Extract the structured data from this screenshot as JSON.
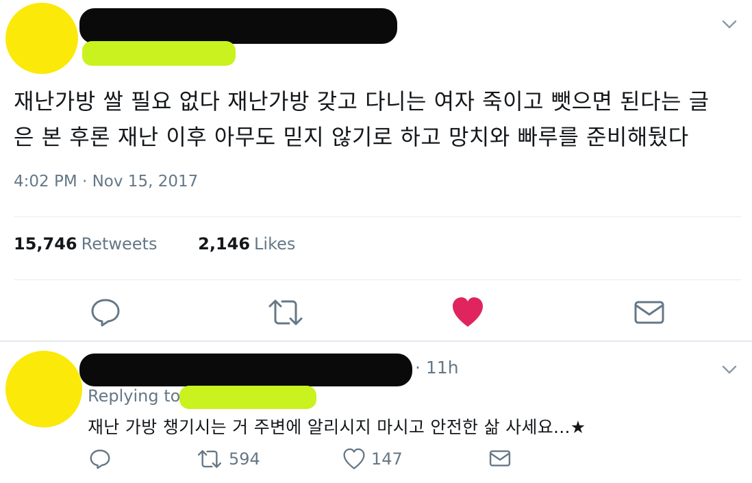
{
  "colors": {
    "avatar": "#fbe90a",
    "redaction": "#0a0a0a",
    "handle_highlight": "#c9f21f",
    "secondary_text": "#657786",
    "like_active": "#e0245e"
  },
  "main_tweet": {
    "text": "재난가방 쌀 필요 없다 재난가방 갖고 다니는 여자 죽이고 뺏으면 된다는 글\n은 본 후론 재난 이후 아무도 믿지 않기로 하고 망치와 빠루를 준비해뒀다",
    "timestamp": "4:02 PM · Nov 15, 2017",
    "retweets_count": "15,746",
    "retweets_label": "Retweets",
    "likes_count": "2,146",
    "likes_label": "Likes",
    "icons": {
      "menu": "chevron-down-icon",
      "reply": "reply-icon",
      "retweet": "retweet-icon",
      "like": "heart-icon",
      "dm": "envelope-icon"
    }
  },
  "reply_tweet": {
    "time": "· 11h",
    "replying_to": "Replying to",
    "text": "재난 가방 챙기시는 거 주변에 알리시지 마시고 안전한 삶 사세요...★",
    "retweets": "594",
    "likes": "147"
  }
}
